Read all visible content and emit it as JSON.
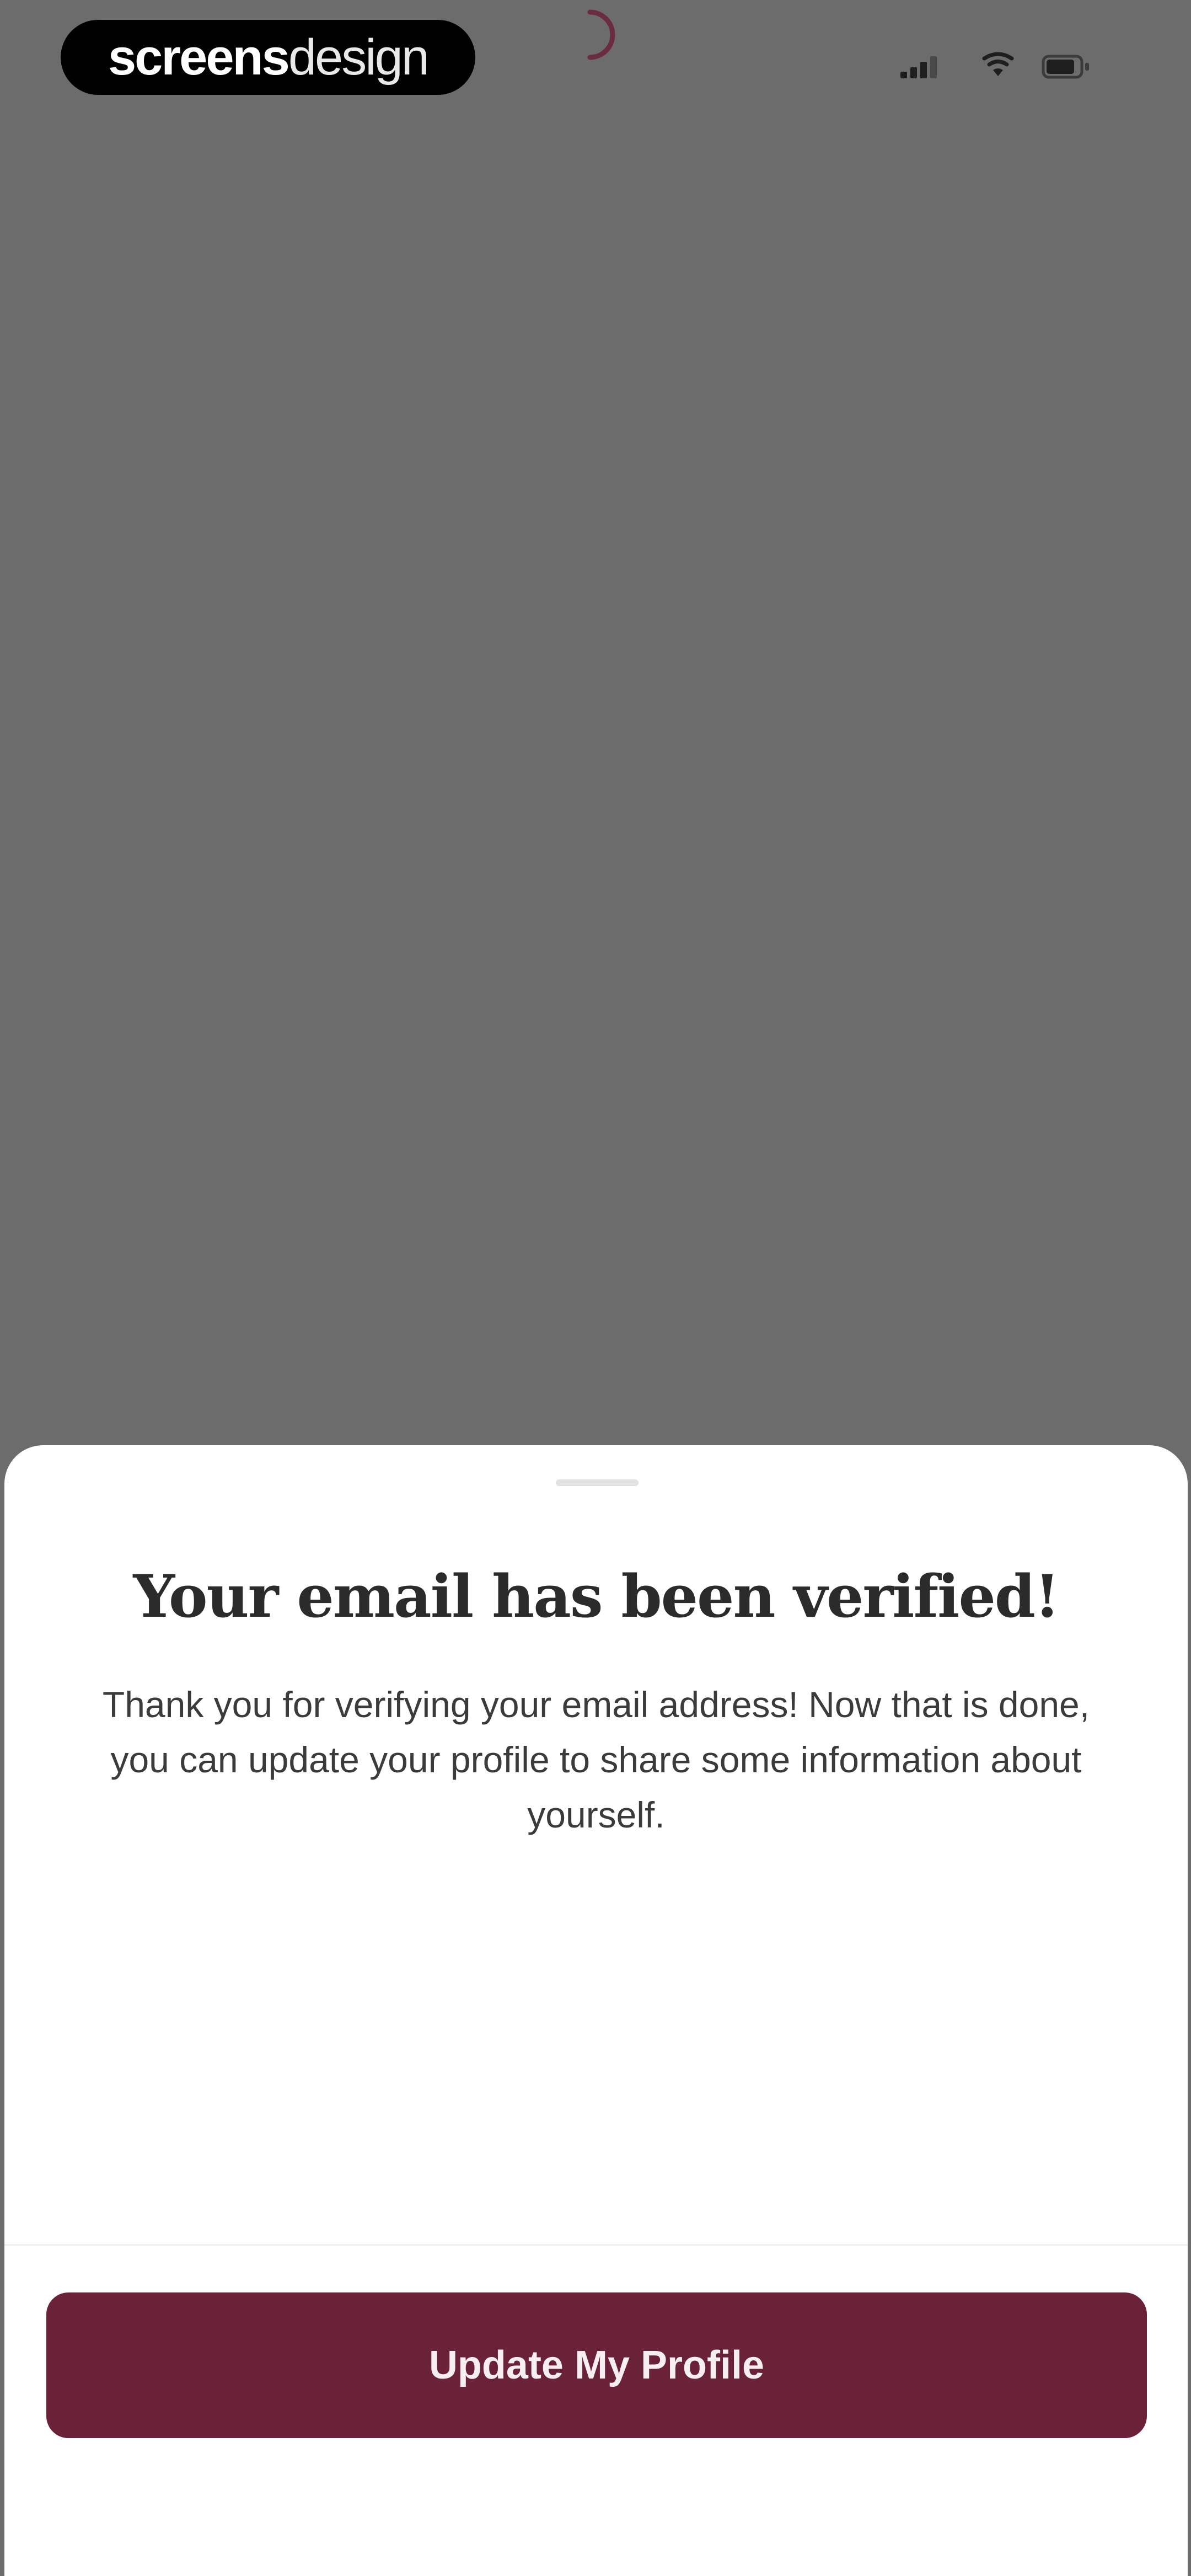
{
  "status_bar": {
    "brand_bold": "screens",
    "brand_light": "design",
    "icons": [
      "signal-icon",
      "wifi-icon",
      "battery-icon"
    ]
  },
  "sheet": {
    "title": "Your email has been verified!",
    "message": "Thank you for verifying your email address! Now that is done, you can update your profile to share some information about yourself.",
    "button_label": "Update My Profile"
  },
  "colors": {
    "backdrop": "#6c6c6c",
    "accent": "#6a2238",
    "sheet_bg": "#ffffff"
  }
}
